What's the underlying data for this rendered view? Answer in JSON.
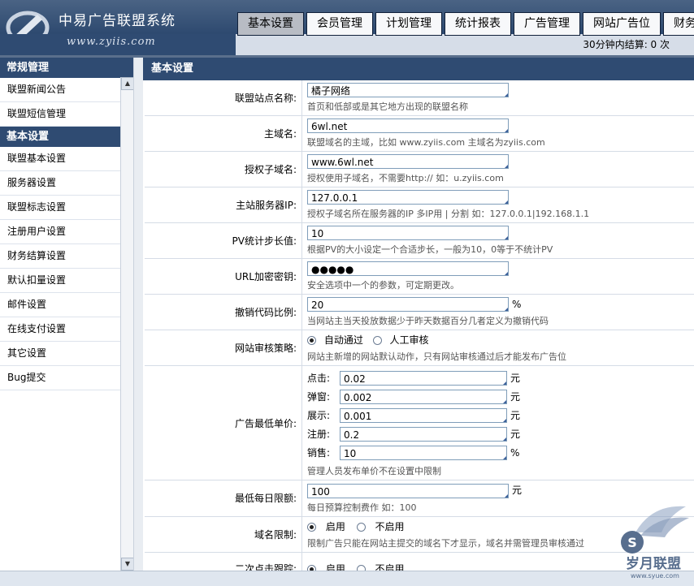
{
  "header": {
    "logo_title": "中易广告联盟系统",
    "logo_url": "www.zyiis.com",
    "tabs": [
      "基本设置",
      "会员管理",
      "计划管理",
      "统计报表",
      "广告管理",
      "网站广告位",
      "财务"
    ],
    "status": "30分钟内结算: 0 次"
  },
  "sidebar": {
    "section1": "常规管理",
    "items1": [
      "联盟新闻公告",
      "联盟短信管理"
    ],
    "section2": "基本设置",
    "items2": [
      "联盟基本设置",
      "服务器设置",
      "联盟标志设置",
      "注册用户设置",
      "财务结算设置",
      "默认扣量设置",
      "邮件设置",
      "在线支付设置",
      "其它设置",
      "Bug提交"
    ]
  },
  "main": {
    "title": "基本设置",
    "site_name": {
      "label": "联盟站点名称:",
      "value": "橘子网络",
      "hint": "首页和低部或是其它地方出现的联盟名称"
    },
    "domain": {
      "label": "主域名:",
      "value": "6wl.net",
      "hint": "联盟域名的主域，比如 www.zyiis.com 主域名为zyiis.com"
    },
    "sub_domain": {
      "label": "授权子域名:",
      "value": "www.6wl.net",
      "hint": "授权使用子域名，不需要http:// 如：u.zyiis.com"
    },
    "server_ip": {
      "label": "主站服务器IP:",
      "value": "127.0.0.1",
      "hint": "授权子域名所在服务器的IP 多IP用 | 分割 如：127.0.0.1|192.168.1.1"
    },
    "pv_step": {
      "label": "PV统计步长值:",
      "value": "10",
      "hint": "根据PV的大小设定一个合适步长，一般为10，0等于不统计PV"
    },
    "url_key": {
      "label": "URL加密密钥:",
      "value": "●●●●●",
      "hint": "安全选项中一个的参数，可定期更改。"
    },
    "revoke_ratio": {
      "label": "撤销代码比例:",
      "value": "20",
      "unit": "%",
      "hint": "当网站主当天投放数据少于昨天数据百分几者定义为撤销代码"
    },
    "audit": {
      "label": "网站审核策略:",
      "opt1": "自动通过",
      "opt2": "人工审核",
      "hint": "网站主新增的网站默认动作，只有网站审核通过后才能发布广告位"
    },
    "min_price": {
      "label": "广告最低单价:",
      "items": [
        {
          "name": "点击:",
          "value": "0.02",
          "unit": "元"
        },
        {
          "name": "弹窗:",
          "value": "0.002",
          "unit": "元"
        },
        {
          "name": "展示:",
          "value": "0.001",
          "unit": "元"
        },
        {
          "name": "注册:",
          "value": "0.2",
          "unit": "元"
        },
        {
          "name": "销售:",
          "value": "10",
          "unit": "%"
        }
      ],
      "hint": "管理人员发布单价不在设置中限制"
    },
    "daily_limit": {
      "label": "最低每日限额:",
      "value": "100",
      "unit": "元",
      "hint": "每日预算控制费作 如：100"
    },
    "domain_limit": {
      "label": "域名限制:",
      "opt1": "启用",
      "opt2": "不启用",
      "hint": "限制广告只能在网站主提交的域名下才显示，域名并需管理员审核通过"
    },
    "second_click": {
      "label": "二次点击跟踪:",
      "opt1": "启用",
      "opt2": "不启用"
    }
  },
  "watermark": {
    "text": "岁月联盟",
    "url": "www.syue.com"
  }
}
